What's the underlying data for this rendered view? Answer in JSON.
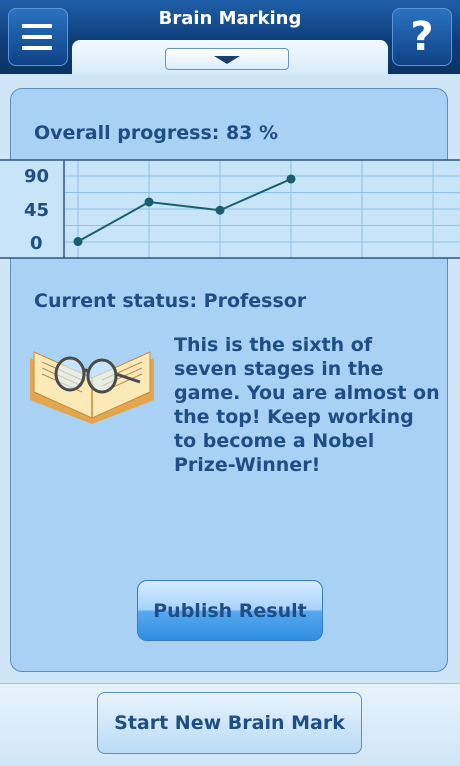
{
  "header": {
    "title": "Brain Marking",
    "help_label": "?",
    "menu_icon": "hamburger-menu-icon",
    "dropdown_icon": "chevron-down-icon"
  },
  "main": {
    "progress_text": "Overall progress: 83 %",
    "status_text": "Current status: Professor",
    "description": "This is the sixth of seven stages in the game. You are almost on the top! Keep working to become a Nobel Prize-Winner!",
    "image_icon": "book-with-glasses-icon",
    "publish_label": "Publish Result"
  },
  "footer": {
    "start_label": "Start New Brain Mark"
  },
  "colors": {
    "header_dark": "#0e3f7a",
    "panel_bg": "#a9d1f4",
    "text_primary": "#1f4d85",
    "chart_line": "#1a5e6e",
    "button_blue": "#2f8fe3"
  },
  "chart_data": {
    "type": "line",
    "y_ticks": [
      "90",
      "45",
      "0"
    ],
    "ylim": [
      0,
      90
    ],
    "xlim": [
      0,
      5
    ],
    "grid": true,
    "series": [
      {
        "values": [
          2,
          55,
          44,
          86
        ]
      }
    ]
  }
}
